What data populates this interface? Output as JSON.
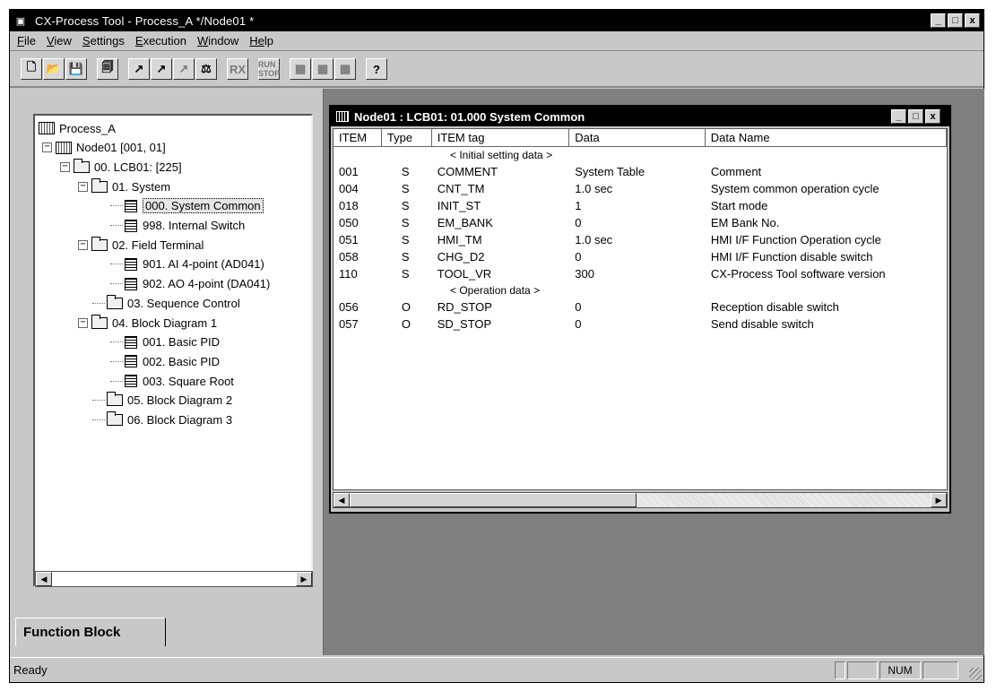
{
  "window": {
    "title": "CX-Process Tool - Process_A */Node01 *",
    "min": "_",
    "max": "□",
    "close": "x"
  },
  "menu": [
    {
      "key": "F",
      "rest": "ile"
    },
    {
      "key": "V",
      "rest": "iew"
    },
    {
      "key": "S",
      "rest": "ettings"
    },
    {
      "key": "E",
      "rest": "xecution"
    },
    {
      "key": "W",
      "rest": "indow"
    },
    {
      "key": "He",
      "rest": "lp",
      "underline_first": true
    }
  ],
  "toolbar": {
    "groups": [
      [
        "new-icon",
        "open-icon",
        "save-icon"
      ],
      [
        "properties-icon"
      ],
      [
        "download-icon",
        "upload-icon",
        "transfer-icon",
        "compare-icon"
      ],
      [
        "rx-icon"
      ],
      [
        "run-stop-icon"
      ],
      [
        "block-icon-1",
        "block-icon-2",
        "block-icon-3"
      ],
      [
        "help-icon"
      ]
    ],
    "glyphs": {
      "new-icon": "🗋",
      "open-icon": "📂",
      "save-icon": "💾",
      "properties-icon": "🗐",
      "download-icon": "↗",
      "upload-icon": "↗",
      "transfer-icon": "↗",
      "compare-icon": "⚖",
      "rx-icon": "RX",
      "run-stop-icon": "RUN STOP",
      "block-icon-1": "▦",
      "block-icon-2": "▦",
      "block-icon-3": "▦",
      "help-icon": "?"
    }
  },
  "tree": {
    "items": [
      {
        "label": "Process_A",
        "icon": "project",
        "indent": 0
      },
      {
        "label": "Node01 [001, 01]",
        "icon": "node",
        "indent": 1,
        "expander": "−"
      },
      {
        "label": "00. LCB01: [225]",
        "icon": "folder",
        "indent": 2,
        "expander": "−"
      },
      {
        "label": "01. System",
        "icon": "folder",
        "indent": 3,
        "expander": "−"
      },
      {
        "label": "000. System Common",
        "icon": "block",
        "indent": 4,
        "selected": true
      },
      {
        "label": "998. Internal Switch",
        "icon": "block",
        "indent": 4
      },
      {
        "label": "02. Field Terminal",
        "icon": "folder",
        "indent": 3,
        "expander": "−"
      },
      {
        "label": "901. AI 4-point (AD041)",
        "icon": "block",
        "indent": 4
      },
      {
        "label": "902. AO 4-point (DA041)",
        "icon": "block",
        "indent": 4
      },
      {
        "label": "03. Sequence Control",
        "icon": "folder",
        "indent": 3
      },
      {
        "label": "04. Block Diagram 1",
        "icon": "folder",
        "indent": 3,
        "expander": "−"
      },
      {
        "label": "001. Basic PID",
        "icon": "block",
        "indent": 4
      },
      {
        "label": "002. Basic PID",
        "icon": "block",
        "indent": 4
      },
      {
        "label": "003. Square Root",
        "icon": "block",
        "indent": 4
      },
      {
        "label": "05. Block Diagram 2",
        "icon": "folder",
        "indent": 3
      },
      {
        "label": "06. Block Diagram 3",
        "icon": "folder",
        "indent": 3
      }
    ]
  },
  "tab": {
    "label": "Function Block"
  },
  "child_window": {
    "title": "Node01 : LCB01: 01.000 System Common",
    "columns": [
      "ITEM",
      "Type",
      "ITEM tag",
      "Data",
      "Data Name"
    ],
    "rows": [
      {
        "section": "< Initial setting data >"
      },
      {
        "item": "001",
        "type": "S",
        "tag": "COMMENT",
        "data": "System Table",
        "name": "Comment"
      },
      {
        "item": "004",
        "type": "S",
        "tag": "CNT_TM",
        "data": "1.0 sec",
        "name": "System common operation cycle"
      },
      {
        "item": "018",
        "type": "S",
        "tag": "INIT_ST",
        "data": "1",
        "name": "Start mode"
      },
      {
        "item": "050",
        "type": "S",
        "tag": "EM_BANK",
        "data": "0",
        "name": "EM Bank No."
      },
      {
        "item": "051",
        "type": "S",
        "tag": "HMI_TM",
        "data": "1.0 sec",
        "name": "HMI I/F Function Operation cycle"
      },
      {
        "item": "058",
        "type": "S",
        "tag": "CHG_D2",
        "data": "0",
        "name": "HMI I/F Function disable switch"
      },
      {
        "item": "110",
        "type": "S",
        "tag": "TOOL_VR",
        "data": "300",
        "name": "CX-Process Tool software version"
      },
      {
        "section": "< Operation data >"
      },
      {
        "item": "056",
        "type": "O",
        "tag": "RD_STOP",
        "data": "0",
        "name": "Reception disable switch"
      },
      {
        "item": "057",
        "type": "O",
        "tag": "SD_STOP",
        "data": "0",
        "name": "Send disable switch"
      }
    ]
  },
  "status": {
    "text": "Ready",
    "num": "NUM"
  }
}
